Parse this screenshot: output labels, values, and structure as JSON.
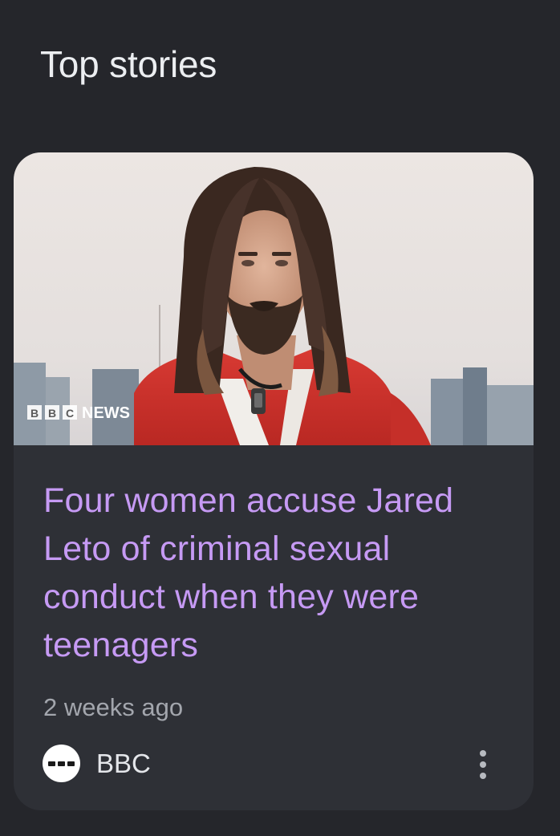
{
  "section": {
    "title": "Top stories"
  },
  "story": {
    "image_alt": "Man with long hair and a beard in a red jacket",
    "image_watermark": {
      "boxes": [
        "B",
        "B",
        "C"
      ],
      "word": "NEWS"
    },
    "headline": "Four women accuse Jared Leto of criminal sexual conduct when they were teenagers",
    "timestamp": "2 weeks ago",
    "source": {
      "name": "BBC",
      "logo_icon": "bbc-logo-icon"
    },
    "menu_icon": "more-vert-icon"
  },
  "colors": {
    "background": "#25262b",
    "card": "#2e3036",
    "headline": "#c69af4",
    "timestamp": "#a3a6ad",
    "jacket": "#d4342e"
  }
}
